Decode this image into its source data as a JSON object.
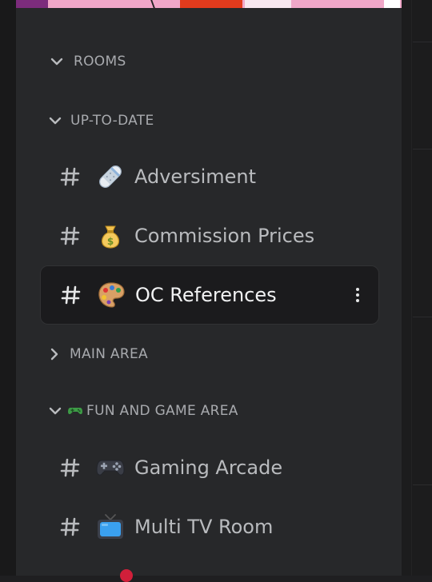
{
  "colors": {
    "sidebar_bg": "#27282a",
    "selected_bg": "#1b1b1d",
    "text_muted": "#a8aaae",
    "text_channel": "#b9bbbe",
    "text_selected": "#f1f2f3"
  },
  "categories": [
    {
      "label": "ROOMS",
      "expanded": true,
      "icon": "chevron-down-icon"
    },
    {
      "label": "UP-TO-DATE",
      "expanded": true,
      "icon": "chevron-down-icon"
    },
    {
      "label": "MAIN AREA",
      "expanded": false,
      "icon": "chevron-right-icon"
    },
    {
      "label": "FUN AND GAME AREA",
      "expanded": true,
      "icon": "chevron-down-icon",
      "prefix_icon": "game-controller-icon"
    }
  ],
  "channels": [
    {
      "label": "Adversiment",
      "emoji": "bandage-icon",
      "selected": false
    },
    {
      "label": "Commission Prices",
      "emoji": "money-bag-icon",
      "selected": false
    },
    {
      "label": "OC References",
      "emoji": "artist-palette-icon",
      "selected": true
    },
    {
      "label": "Gaming Arcade",
      "emoji": "video-game-icon",
      "selected": false
    },
    {
      "label": "Multi TV Room",
      "emoji": "television-icon",
      "selected": false
    }
  ]
}
